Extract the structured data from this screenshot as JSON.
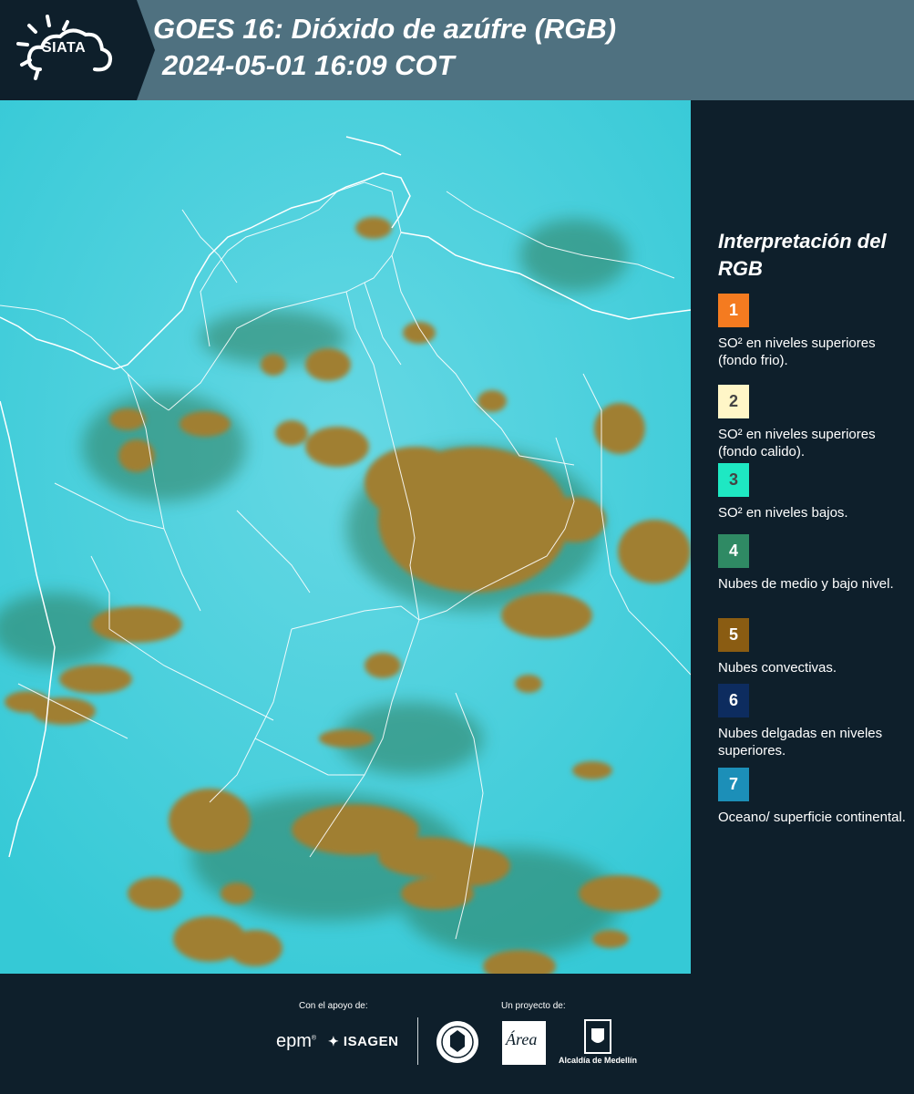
{
  "header": {
    "logo_text": "SIATA",
    "title_line1": "GOES 16: Dióxido de azúfre (RGB)",
    "title_line2": "2024-05-01 16:09 COT"
  },
  "legend": {
    "title": "Interpretación del RGB",
    "items": [
      {
        "number": "1",
        "label": "SO² en niveles superiores (fondo frio).",
        "color": "#f47b20",
        "text_color": "#ffffff"
      },
      {
        "number": "2",
        "label": "SO² en niveles superiores (fondo calido).",
        "color": "#fff6c7",
        "text_color": "#444444"
      },
      {
        "number": "3",
        "label": "SO² en niveles bajos.",
        "color": "#1ee8c3",
        "text_color": "#444444"
      },
      {
        "number": "4",
        "label": "Nubes de medio y bajo nivel.",
        "color": "#2f8a64",
        "text_color": "#ffffff"
      },
      {
        "number": "5",
        "label": "Nubes convectivas.",
        "color": "#8a5c12",
        "text_color": "#ffffff"
      },
      {
        "number": "6",
        "label": "Nubes delgadas en niveles superiores.",
        "color": "#0d2c5f",
        "text_color": "#ffffff"
      },
      {
        "number": "7",
        "label": "Oceano/ superficie continental.",
        "color": "#1c8fb8",
        "text_color": "#ffffff"
      }
    ]
  },
  "footer": {
    "support_label": "Con el apoyo de:",
    "project_label": "Un proyecto de:",
    "sponsor1": "epm",
    "sponsor2": "ISAGEN",
    "area_text": "Área",
    "alcaldia": "Alcaldía de Medellín"
  },
  "colors": {
    "background": "#0e1f2b",
    "header_bar": "#4f7180",
    "map_base": "#3fd2dd",
    "cloud_convective": "#9a7a2c",
    "cloud_shadow": "#2d6f55"
  }
}
